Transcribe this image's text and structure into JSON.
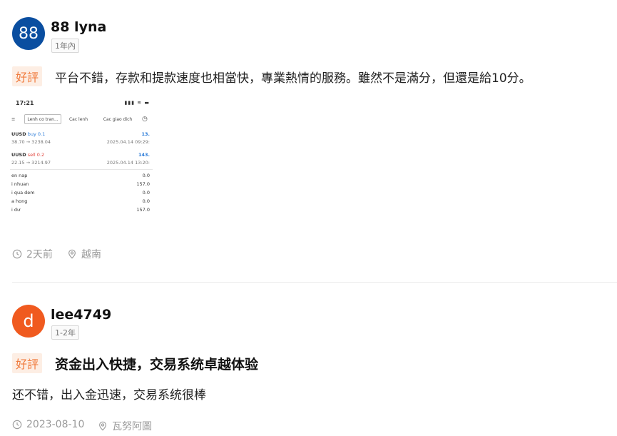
{
  "reviews": [
    {
      "avatar_text": "88",
      "username": "88 lyna",
      "tenure": "1年內",
      "badge": "好評",
      "text": "平台不錯，存款和提款速度也相當快，專業熱情的服務。雖然不是滿分，但還是給10分。",
      "time": "2天前",
      "location": "越南",
      "screenshot": {
        "status_time": "17:21",
        "status_icons": "▮▮▮ ≋ ▬",
        "tabs": [
          "Lenh co tran...",
          "Cac lenh",
          "Cac giao dich"
        ],
        "orders": [
          {
            "symbol": "UUSD",
            "side": "buy 0.1",
            "value": "13.",
            "prices": "38.70 → 3238.04",
            "date": "2025.04.14 09:29:"
          },
          {
            "symbol": "UUSD",
            "side": "sell 0.2",
            "value": "143.",
            "prices": "22.15 → 3214.97",
            "date": "2025.04.14 13:20:"
          }
        ],
        "summary": [
          {
            "label": "en nap",
            "value": "0.0"
          },
          {
            "label": "i nhuan",
            "value": "157.0"
          },
          {
            "label": "i qua dem",
            "value": "0.0"
          },
          {
            "label": "a hong",
            "value": "0.0"
          },
          {
            "label": "i dư",
            "value": "157.0"
          }
        ]
      }
    },
    {
      "avatar_text": "d",
      "username": "lee4749",
      "tenure": "1-2年",
      "badge": "好評",
      "title": "资金出入快捷，交易系统卓越体验",
      "text": "还不错，出入金迅速，交易系统很棒",
      "time": "2023-08-10",
      "location": "瓦努阿圖"
    }
  ],
  "colors": {
    "avatar1": "#0a4ea0",
    "avatar2": "#f05a1f",
    "badge_bg": "#fdeee4",
    "badge_text": "#f07a3c",
    "meta_text": "#9a9a9a"
  },
  "icons": [
    "clock-icon",
    "location-pin-icon",
    "menu-icon",
    "history-clock-icon"
  ]
}
